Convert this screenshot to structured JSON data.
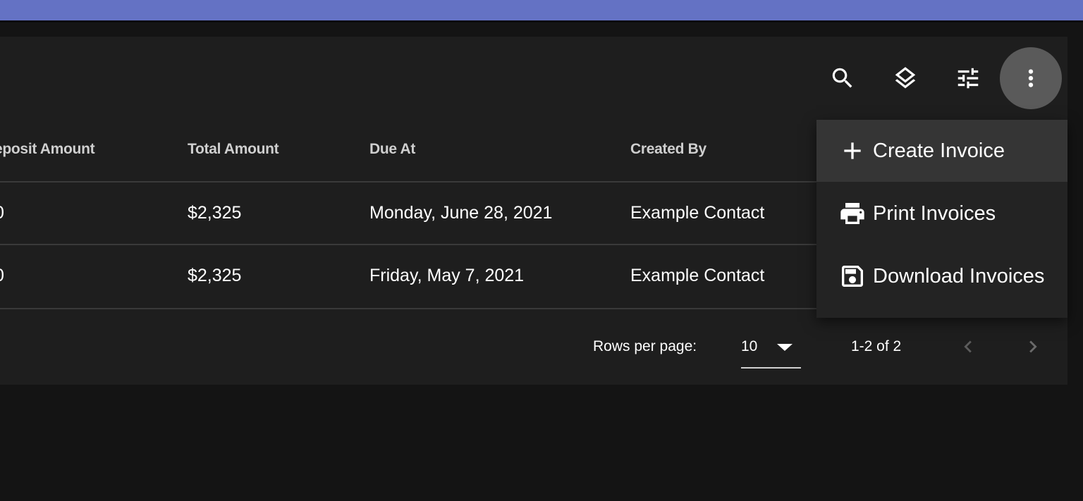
{
  "toolbar": {
    "icons": [
      "search-icon",
      "layers-icon",
      "tune-icon",
      "more-vert-icon"
    ]
  },
  "table": {
    "columns": [
      "eposit Amount",
      "Total Amount",
      "Due At",
      "Created By"
    ],
    "rows": [
      {
        "deposit": "0",
        "total": "$2,325",
        "due_at": "Monday, June 28, 2021",
        "created_by": "Example Contact"
      },
      {
        "deposit": "0",
        "total": "$2,325",
        "due_at": "Friday, May 7, 2021",
        "created_by": "Example Contact"
      }
    ]
  },
  "pagination": {
    "rows_per_page_label": "Rows per page:",
    "rows_per_page_value": "10",
    "range": "1-2 of 2"
  },
  "menu": {
    "items": [
      {
        "label": "Create Invoice",
        "icon": "plus-icon"
      },
      {
        "label": "Print Invoices",
        "icon": "printer-icon"
      },
      {
        "label": "Download Invoices",
        "icon": "floppy-disk-icon"
      }
    ]
  },
  "colors": {
    "topbar": "#6472c4",
    "panel": "#1e1e1e",
    "background": "#141414",
    "menu": "#232323",
    "menu_hover": "#353535"
  }
}
